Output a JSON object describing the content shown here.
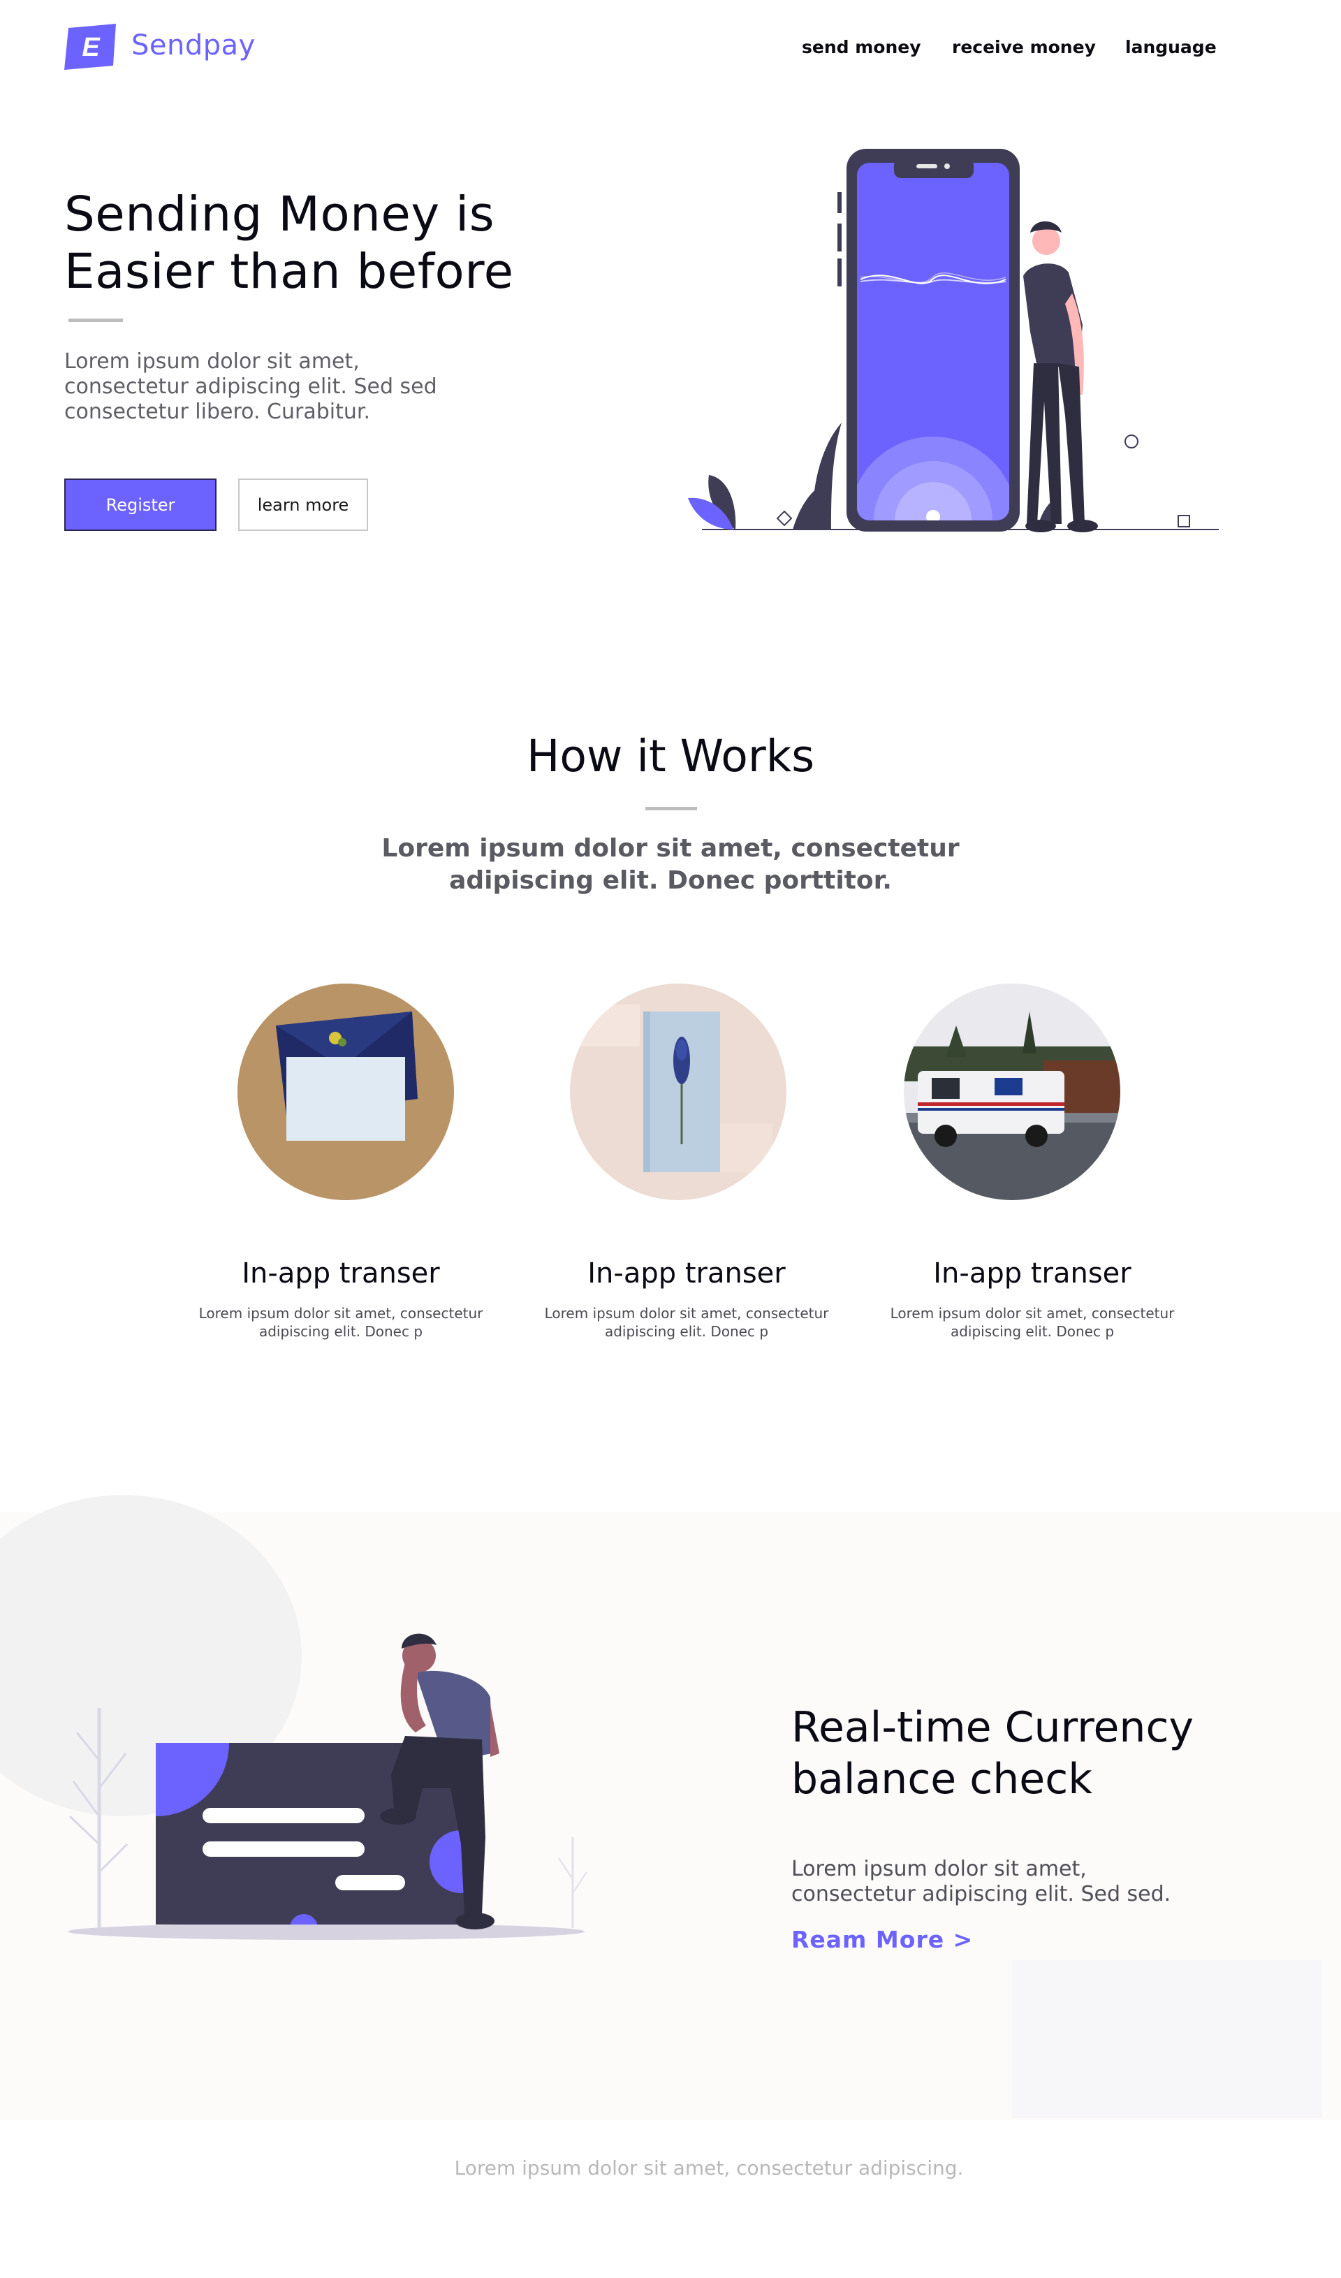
{
  "brand": {
    "name": "Sendpay",
    "logo_letter": "E",
    "accent": "#6c63ff"
  },
  "nav": {
    "links": [
      "send money",
      "receive money",
      "language"
    ]
  },
  "hero": {
    "title_line1": "Sending Money is",
    "title_line2": "Easier than before",
    "text_line1": "Lorem ipsum dolor sit amet,",
    "text_line2": "consectetur adipiscing elit. Sed sed",
    "text_line3": "consectetur libero. Curabitur.",
    "register_label": "Register",
    "learn_label": "learn more"
  },
  "how": {
    "title": "How it Works",
    "sub_line1": "Lorem ipsum dolor sit amet, consectetur",
    "sub_line2": "adipiscing elit. Donec porttitor.",
    "cards": [
      {
        "title": "In-app transer",
        "text_line1": "Lorem ipsum dolor sit amet, consectetur",
        "text_line2": "adipiscing elit. Donec p"
      },
      {
        "title": "In-app transer",
        "text_line1": "Lorem ipsum dolor sit amet, consectetur",
        "text_line2": "adipiscing elit. Donec p"
      },
      {
        "title": "In-app transer",
        "text_line1": "Lorem ipsum dolor sit amet, consectetur",
        "text_line2": "adipiscing elit. Donec p"
      }
    ]
  },
  "realtime": {
    "title_line1": "Real-time Currency",
    "title_line2": "balance check",
    "text_line1": "Lorem ipsum dolor sit amet,",
    "text_line2": "consectetur adipiscing elit. Sed sed.",
    "link_label": "Ream More >"
  },
  "footer": {
    "text": "Lorem ipsum dolor sit amet, consectetur adipiscing."
  }
}
